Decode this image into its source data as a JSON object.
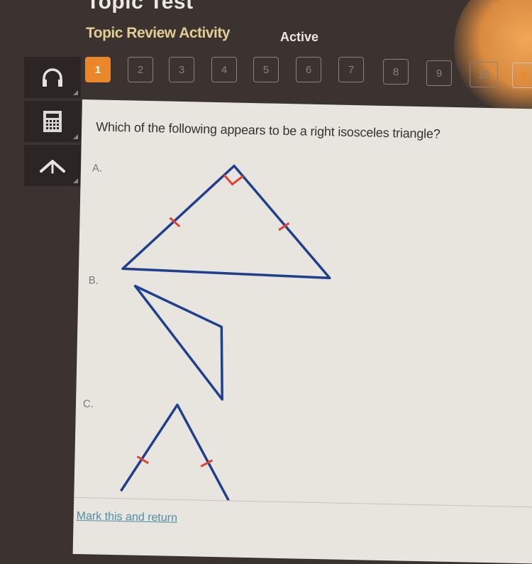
{
  "header": {
    "title": "Topic Test",
    "subtitle": "Topic Review Activity",
    "status": "Active"
  },
  "question_nav": {
    "current": 1,
    "items": [
      "1",
      "2",
      "3",
      "4",
      "5",
      "6",
      "7",
      "8",
      "9",
      "10"
    ],
    "next_icon": "play-triangle-icon"
  },
  "toolbar": {
    "tools": [
      {
        "name": "audio",
        "icon": "headphones-icon"
      },
      {
        "name": "calculator",
        "icon": "calculator-icon"
      },
      {
        "name": "reference",
        "icon": "arrow-up-icon"
      }
    ]
  },
  "question": {
    "text": "Which of the following appears to be a right isosceles triangle?",
    "options": [
      {
        "label": "A.",
        "description": "Triangle with right-angle mark at top vertex and tick marks on both legs"
      },
      {
        "label": "B.",
        "description": "Scalene obtuse triangle without marks"
      },
      {
        "label": "C.",
        "description": "Triangle with apex at top and tick marks on both sides"
      }
    ]
  },
  "colors": {
    "accent": "#e8882a",
    "shape_stroke": "#1f3f8f",
    "mark_stroke": "#e2412f",
    "link": "#4d8fa8"
  },
  "footer": {
    "mark_link": "Mark this and return"
  }
}
